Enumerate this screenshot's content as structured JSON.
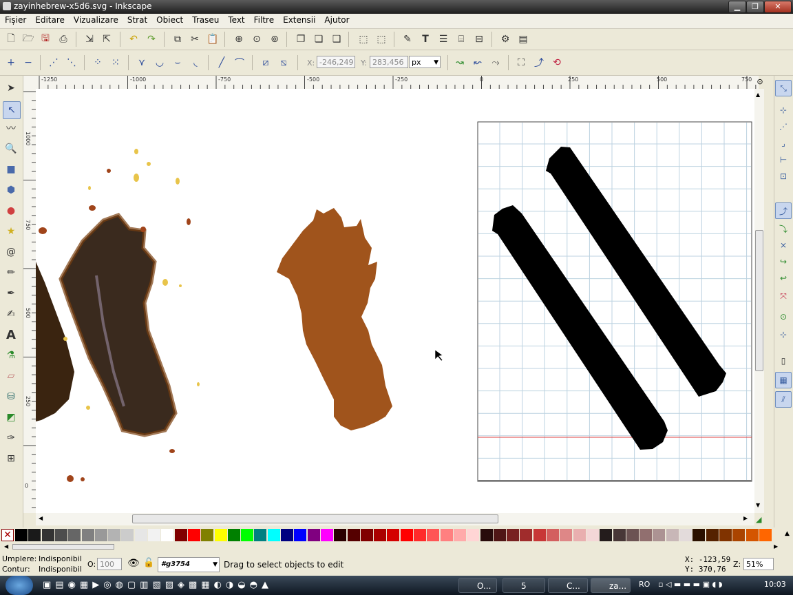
{
  "window": {
    "title": "zayinhebrew-x5d6.svg - Inkscape",
    "min": "▁",
    "max": "❐",
    "close": "✕"
  },
  "menu": [
    "Fișier",
    "Editare",
    "Vizualizare",
    "Strat",
    "Obiect",
    "Traseu",
    "Text",
    "Filtre",
    "Extensii",
    "Ajutor"
  ],
  "node_toolbar": {
    "x_label": "X:",
    "x_value": "-246,249",
    "y_label": "Y:",
    "y_value": "283,456",
    "unit": "px"
  },
  "hruler": {
    "labels": [
      "-1250",
      "-1000",
      "-750",
      "-500",
      "-250",
      "0",
      "250",
      "500",
      "750"
    ]
  },
  "vruler": {
    "labels": [
      "1000",
      "750",
      "500",
      "250",
      "0"
    ]
  },
  "palette": {
    "colors": [
      "#000000",
      "#1a1a1a",
      "#333333",
      "#4d4d4d",
      "#666666",
      "#808080",
      "#999999",
      "#b3b3b3",
      "#cccccc",
      "#e6e6e6",
      "#f2f2f2",
      "#ffffff",
      "#800000",
      "#ff0000",
      "#808000",
      "#ffff00",
      "#008000",
      "#00ff00",
      "#008080",
      "#00ffff",
      "#000080",
      "#0000ff",
      "#800080",
      "#ff00ff",
      "#2b0000",
      "#550000",
      "#800000",
      "#aa0000",
      "#d40000",
      "#ff0000",
      "#ff2a2a",
      "#ff5555",
      "#ff8080",
      "#ffaaaa",
      "#ffd5d5",
      "#280b0b",
      "#501616",
      "#782121",
      "#a02c2c",
      "#c83737",
      "#d35f5f",
      "#de8787",
      "#e9afaf",
      "#f4d7d7",
      "#241c1c",
      "#483737",
      "#6c5353",
      "#916f6f",
      "#ac9393",
      "#c8b7b7",
      "#e3dbdb",
      "#2b1100",
      "#552200",
      "#803300",
      "#aa4400",
      "#d45500",
      "#ff6600"
    ]
  },
  "status": {
    "fill_label": "Umplere:",
    "fill_value": "Indisponibil",
    "stroke_label": "Contur:",
    "stroke_value": "Indisponibil",
    "opacity_label": "O:",
    "opacity_value": "100",
    "layer": "#g3754",
    "message": "Drag to select objects to edit",
    "cursor_x": "X: -123,59",
    "cursor_y": "Y:  370,76",
    "zoom_label": "Z:",
    "zoom_value": "51%"
  },
  "taskbar": {
    "buttons": [
      "O...",
      "5",
      "C...",
      "za..."
    ],
    "lang": "RO",
    "clock": "10:03"
  }
}
